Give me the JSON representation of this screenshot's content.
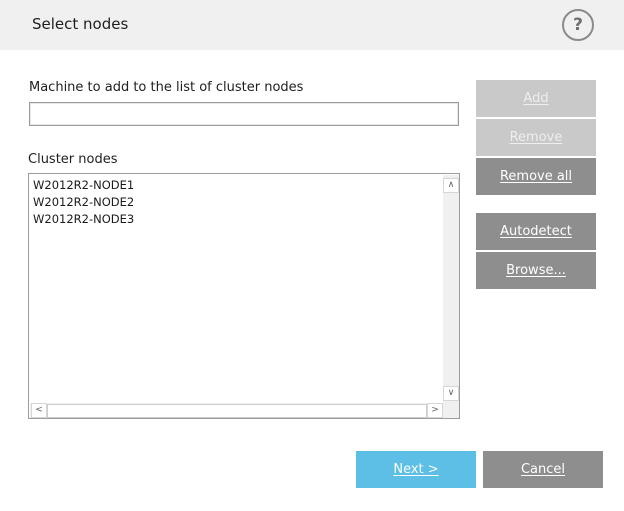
{
  "dialog": {
    "title": "Select nodes",
    "help_label": "?"
  },
  "machine": {
    "label": "Machine to add to the list of cluster nodes",
    "value": ""
  },
  "cluster": {
    "label": "Cluster nodes",
    "nodes": [
      "W2012R2-NODE1",
      "W2012R2-NODE2",
      "W2012R2-NODE3"
    ]
  },
  "scrollbar": {
    "up_arrow": "∧",
    "down_arrow": "∨",
    "left_arrow": "<",
    "right_arrow": ">"
  },
  "buttons": {
    "add": "Add",
    "remove": "Remove",
    "remove_all": "Remove all",
    "autodetect": "Autodetect",
    "browse": "Browse...",
    "next": "Next >",
    "cancel": "Cancel"
  },
  "colors": {
    "header_bg": "#f0f0f0",
    "primary_button": "#5dbee6",
    "secondary_button": "#8e8e8e",
    "disabled_button": "#c9c9c9"
  }
}
